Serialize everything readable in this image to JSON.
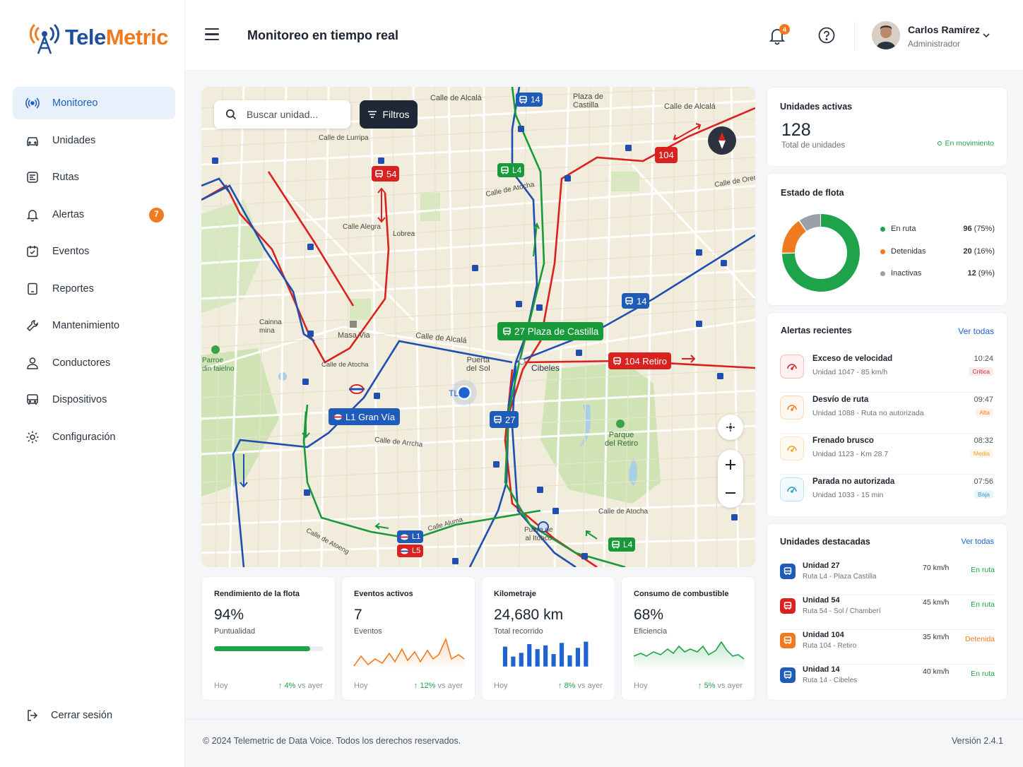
{
  "brand": {
    "part1": "Tele",
    "part2": "Metric",
    "primary_color": "#1f4f9a",
    "accent_color": "#f07a1f"
  },
  "sidebar": {
    "items": [
      {
        "label": "Monitoreo",
        "icon": "broadcast-icon",
        "active": true
      },
      {
        "label": "Unidades",
        "icon": "car-icon"
      },
      {
        "label": "Rutas",
        "icon": "route-icon"
      },
      {
        "label": "Alertas",
        "icon": "bell-icon",
        "badge": "7"
      },
      {
        "label": "Eventos",
        "icon": "calendar-icon"
      },
      {
        "label": "Reportes",
        "icon": "report-icon"
      },
      {
        "label": "Mantenimiento",
        "icon": "wrench-icon"
      },
      {
        "label": "Conductores",
        "icon": "user-icon"
      },
      {
        "label": "Dispositivos",
        "icon": "bus-icon"
      },
      {
        "label": "Configuración",
        "icon": "gear-icon"
      }
    ],
    "logout": "Cerrar sesión"
  },
  "header": {
    "title": "Monitoreo en tiempo real",
    "notifications": "4",
    "user": {
      "name": "Carlos Ramírez",
      "role": "Administrador"
    }
  },
  "map": {
    "search_placeholder": "Buscar unidad...",
    "filters_label": "Filtros",
    "current_marker": "TL1",
    "badges": {
      "b14_top": "14",
      "b54": "54",
      "b104": "104",
      "l4_top": "L4",
      "castilla": "27 Plaza de Castilla",
      "retiro": "104 Retiro",
      "b14_mid": "14",
      "granvia": "L1 Gran Vía",
      "b27": "27",
      "l1": "L1",
      "l5": "L5",
      "l4_bottom": "L4"
    },
    "labels": {
      "alcala1": "Calle de Alcalá",
      "alcala2": "Calle de Alcalá",
      "alcala3": "Calle de Alcalá",
      "alcala4": "Calle de Alcalá",
      "plaza": "Plaza de\nCastilla",
      "lurripa": "Calle de Lurripa",
      "atocha1": "Calle de Atocha",
      "atocha2": "Calle de Atocha",
      "atocha3": "Calle de Atocha",
      "alegra": "Calle Alegra",
      "lobrea": "Lobrea",
      "caina": "Cainna\nmina",
      "masavia": "Masa Via",
      "puerta": "Puerta\ndel Sol",
      "cibeles": "Cibeles",
      "parque_retiro": "Parque\ndel Retiro",
      "parque_lateral": "Parroe\ndin faielno",
      "arrecha": "Calle de Arrcha",
      "puerta2": "Puera de\nal Itobco",
      "carena": "Calle de Orena",
      "atocha_bl": "Calle de Atoeng",
      "carbolla": "Calle Aluma"
    }
  },
  "cards": {
    "active_units": {
      "title": "Unidades activas",
      "value": "128",
      "subtitle": "Total de unidades",
      "status": "En movimiento"
    },
    "fleet": {
      "title": "Estado de flota",
      "legend": [
        {
          "label": "En ruta",
          "count": "96",
          "pct": "(75%)",
          "color": "#1fa34a"
        },
        {
          "label": "Detenidas",
          "count": "20",
          "pct": "(16%)",
          "color": "#f07a1f"
        },
        {
          "label": "Inactivas",
          "count": "12",
          "pct": "(9%)",
          "color": "#9aa0a8"
        }
      ]
    },
    "alerts": {
      "title": "Alertas recientes",
      "link": "Ver todas",
      "items": [
        {
          "title": "Exceso de velocidad",
          "sub": "Unidad 1047 - 85 km/h",
          "time": "10:24",
          "severity": "Crítica",
          "color": "#d9221f"
        },
        {
          "title": "Desvío de ruta",
          "sub": "Unidad 1088 - Ruta no autorizada",
          "time": "09:47",
          "severity": "Alta",
          "color": "#f07a1f"
        },
        {
          "title": "Frenado brusco",
          "sub": "Unidad 1123 - Km 28.7",
          "time": "08:32",
          "severity": "Media",
          "color": "#f0a21f"
        },
        {
          "title": "Parada no autorizada",
          "sub": "Unidad 1033 - 15 min",
          "time": "07:56",
          "severity": "Baja",
          "color": "#2aa0c8"
        }
      ]
    },
    "units": {
      "title": "Unidades destacadas",
      "link": "Ver todas",
      "items": [
        {
          "title": "Unidad 27",
          "sub": "Ruta L4 - Plaza Castilla",
          "speed": "70 km/h",
          "status": "En ruta",
          "color": "#1f5bb8",
          "status_color": "#1fa34a"
        },
        {
          "title": "Unidad 54",
          "sub": "Ruta 54 - Sol / Chamberí",
          "speed": "45 km/h",
          "status": "En ruta",
          "color": "#d9221f",
          "status_color": "#1fa34a"
        },
        {
          "title": "Unidad 104",
          "sub": "Ruta 104 - Retiro",
          "speed": "35 km/h",
          "status": "Detenida",
          "color": "#f07a1f",
          "status_color": "#f07a1f"
        },
        {
          "title": "Unidad 14",
          "sub": "Ruta 14 - Cibeles",
          "speed": "40 km/h",
          "status": "En ruta",
          "color": "#1f5bb8",
          "status_color": "#1fa34a"
        }
      ]
    }
  },
  "kpis": [
    {
      "title": "Rendimiento de la flota",
      "value": "94%",
      "sub": "Puntualidad",
      "day": "Hoy",
      "change": "4%",
      "vs": "vs ayer",
      "progress": 0.88
    },
    {
      "title": "Eventos activos",
      "value": "7",
      "sub": "Eventos",
      "day": "Hoy",
      "change": "12%",
      "vs": "vs ayer"
    },
    {
      "title": "Kilometraje",
      "value": "24,680 km",
      "sub": "Total recorrido",
      "day": "Hoy",
      "change": "8%",
      "vs": "vs ayer"
    },
    {
      "title": "Consumo de combustible",
      "value": "68%",
      "sub": "Eficiencia",
      "day": "Hoy",
      "change": "5%",
      "vs": "vs ayer"
    }
  ],
  "footer": {
    "copyright": "© 2024 Telemetric de Data Voice. Todos los derechos reservados.",
    "version": "Versión 2.4.1"
  }
}
